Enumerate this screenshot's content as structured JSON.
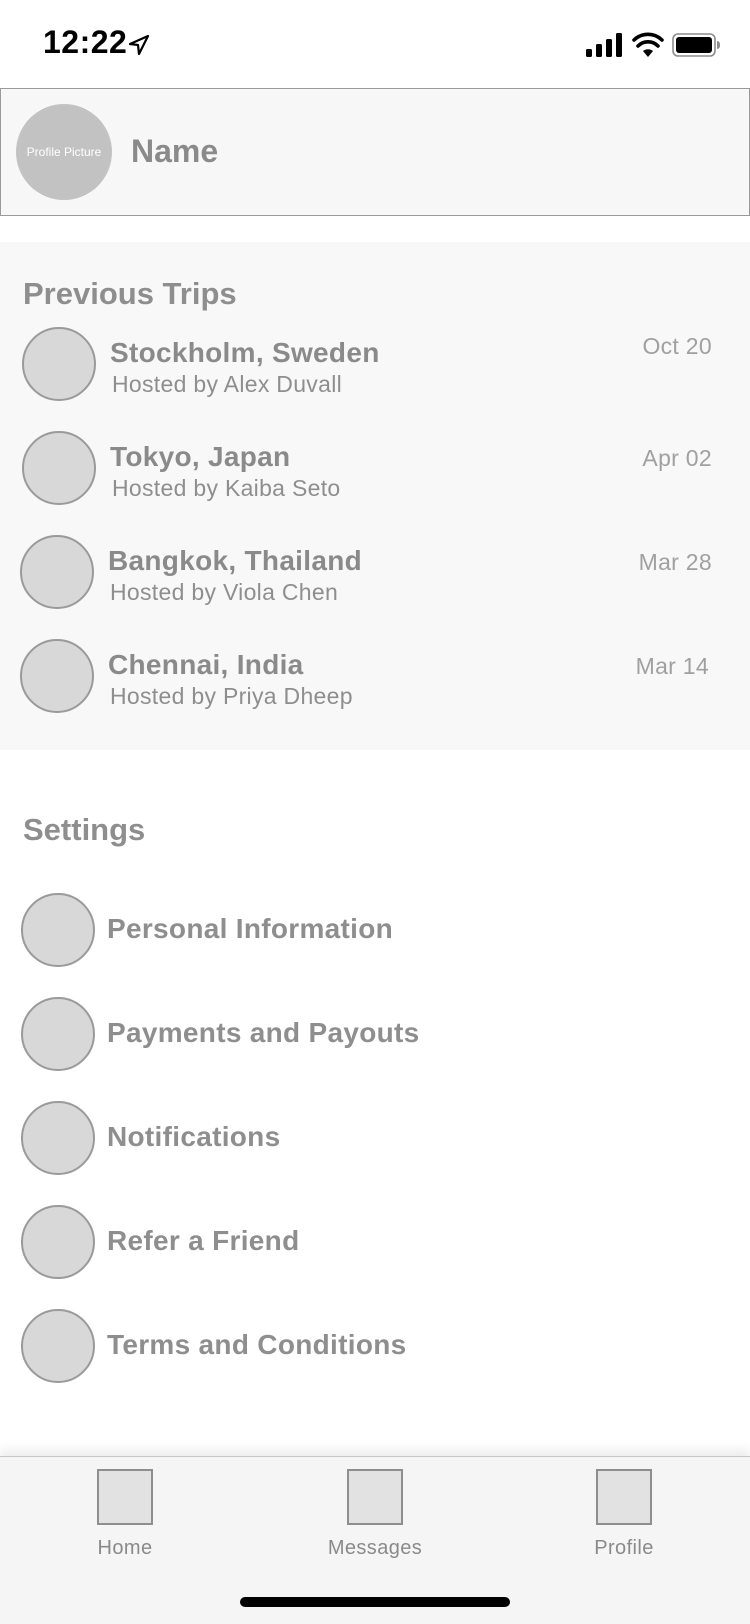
{
  "status_bar": {
    "time": "12:22",
    "icons": [
      "location-arrow-icon",
      "cellular-signal-icon",
      "wifi-icon",
      "battery-icon"
    ]
  },
  "profile": {
    "picture_label": "Profile Picture",
    "name": "Name"
  },
  "previous_trips": {
    "title": "Previous Trips",
    "items": [
      {
        "city": "Stockholm, Sweden",
        "host": "Hosted by Alex Duvall",
        "date": "Oct 20"
      },
      {
        "city": "Tokyo, Japan",
        "host": "Hosted by Kaiba Seto",
        "date": "Apr 02"
      },
      {
        "city": "Bangkok, Thailand",
        "host": "Hosted by Viola Chen",
        "date": "Mar 28"
      },
      {
        "city": "Chennai, India",
        "host": "Hosted by Priya Dheep",
        "date": "Mar 14"
      }
    ]
  },
  "settings": {
    "title": "Settings",
    "items": [
      {
        "label": "Personal Information"
      },
      {
        "label": "Payments and Payouts"
      },
      {
        "label": "Notifications"
      },
      {
        "label": "Refer a Friend"
      },
      {
        "label": "Terms and Conditions"
      }
    ]
  },
  "tab_bar": {
    "tabs": [
      {
        "label": "Home",
        "icon": "home-icon"
      },
      {
        "label": "Messages",
        "icon": "messages-icon"
      },
      {
        "label": "Profile",
        "icon": "profile-icon"
      }
    ]
  },
  "colors": {
    "placeholder_fill": "#d8d8d8",
    "placeholder_stroke": "#9a9a9a",
    "text_gray": "#8e8e8e",
    "section_bg": "#f8f8f8"
  }
}
